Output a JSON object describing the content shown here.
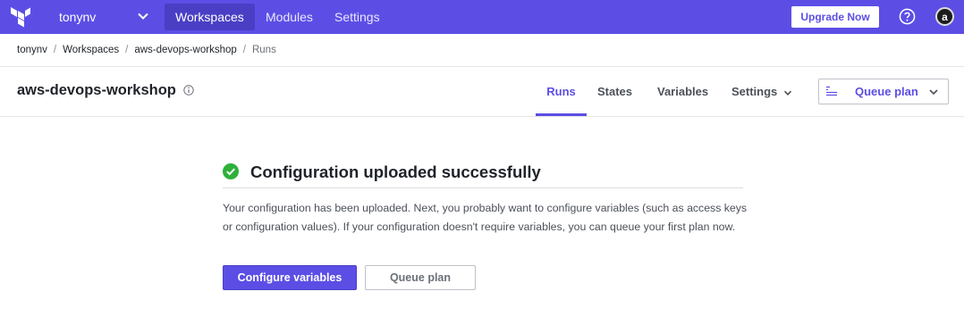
{
  "topbar": {
    "org_name": "tonynv",
    "nav": {
      "workspaces": "Workspaces",
      "modules": "Modules",
      "settings": "Settings"
    },
    "upgrade_label": "Upgrade Now",
    "avatar_letter": "a",
    "icons": {
      "logo": "terraform-logo",
      "org_dropdown": "chevron-down-icon",
      "help": "help-circle-icon"
    }
  },
  "breadcrumb": {
    "items": [
      "tonynv",
      "Workspaces",
      "aws-devops-workshop",
      "Runs"
    ],
    "separator": "/"
  },
  "workspace": {
    "name": "aws-devops-workshop",
    "tabs": {
      "runs": "Runs",
      "states": "States",
      "variables": "Variables",
      "settings": "Settings"
    },
    "active_tab": "Runs",
    "queue_plan_label": "Queue plan"
  },
  "main": {
    "heading": "Configuration uploaded successfully",
    "body": "Your configuration has been uploaded. Next, you probably want to configure variables (such as access keys or configuration values). If your configuration doesn't require variables, you can queue your first plan now.",
    "primary_button": "Configure variables",
    "secondary_button": "Queue plan"
  },
  "colors": {
    "brand": "#5c4ee5",
    "success": "#2eb039",
    "text": "#1f2329"
  }
}
